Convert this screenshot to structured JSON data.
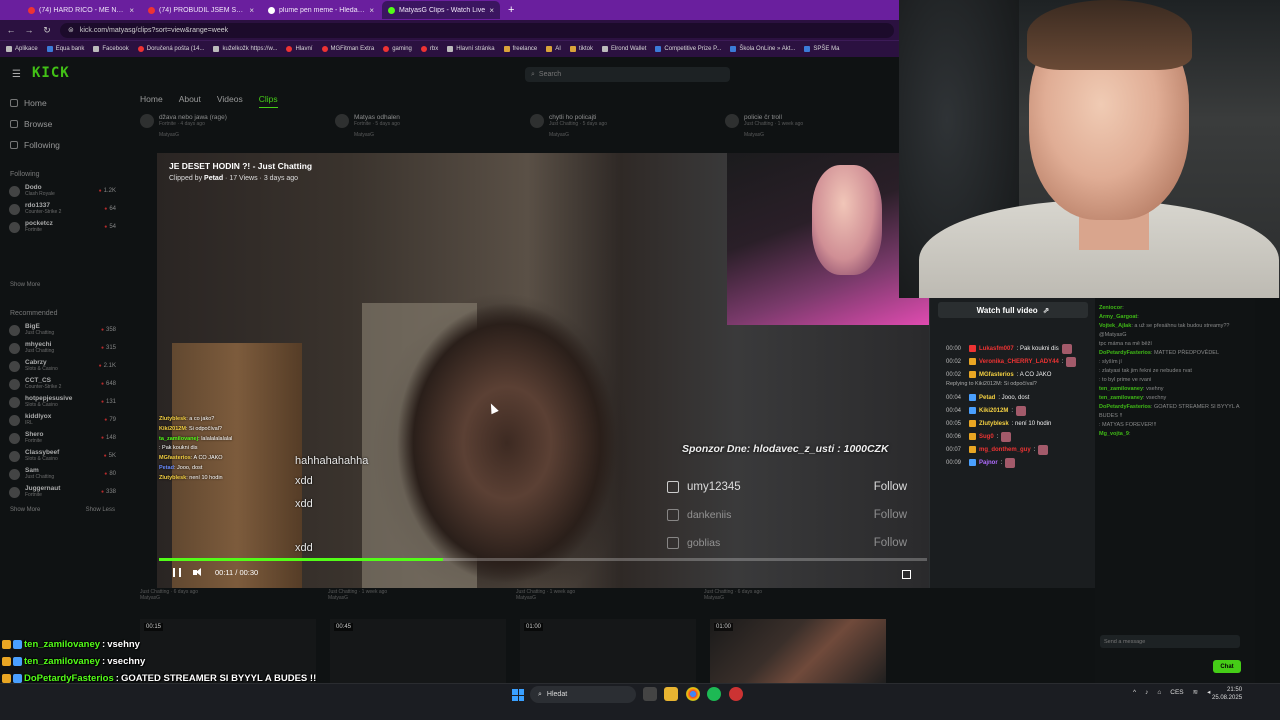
{
  "browser": {
    "tabs": [
      {
        "label": "(74) HARD RICO - MÉ NEDOSTI",
        "icon": "youtube-icon",
        "active": false
      },
      {
        "label": "(74) PROBUDIL JSEM SOUSEDE",
        "icon": "youtube-icon",
        "active": false
      },
      {
        "label": "plume pen meme - Hledat Goo",
        "icon": "google-icon",
        "active": false
      },
      {
        "label": "MatyasG Clips - Watch Live",
        "icon": "kick-icon",
        "active": true
      }
    ],
    "url": "kick.com/matyasg/clips?sort=view&range=week",
    "bookmarks": [
      "Aplikace",
      "Equa bank",
      "Facebook",
      "Doručená pošta (14...",
      "kuželkožk https://w...",
      "Hlavní",
      "MGFitman Extra",
      "gaming",
      "rbx",
      "Hlavní stránka",
      "freelance",
      "AI",
      "tiktok",
      "Elrond Wallet",
      "Competitive Prize P...",
      "Škola OnLine » Akt...",
      "SPŠE Ma"
    ]
  },
  "kick": {
    "search_placeholder": "Search",
    "nav": [
      "Home",
      "Browse",
      "Following"
    ],
    "following_title": "Following",
    "following": [
      {
        "name": "Dodo",
        "game": "Clash Royale",
        "viewers": "1.2K"
      },
      {
        "name": "rdo1337",
        "game": "Counter-Strike 2",
        "viewers": "64"
      },
      {
        "name": "pocketcz",
        "game": "Fortnite",
        "viewers": "54"
      }
    ],
    "show_more": "Show More",
    "recommended_title": "Recommended",
    "recommended": [
      {
        "name": "BigE",
        "game": "Just Chatting",
        "viewers": "358"
      },
      {
        "name": "mhyechi",
        "game": "Just Chatting",
        "viewers": "315"
      },
      {
        "name": "Cabrzy",
        "game": "Slots & Casino",
        "viewers": "2.1K"
      },
      {
        "name": "CCT_CS",
        "game": "Counter-Strike 2",
        "viewers": "648"
      },
      {
        "name": "hotpepjesusive",
        "game": "Slots & Casino",
        "viewers": "131"
      },
      {
        "name": "kiddlyox",
        "game": "IRL",
        "viewers": "79"
      },
      {
        "name": "Shero",
        "game": "Fortnite",
        "viewers": "148"
      },
      {
        "name": "Classybeef",
        "game": "Slots & Casino",
        "viewers": "5K"
      },
      {
        "name": "Sam",
        "game": "Just Chatting",
        "viewers": "80"
      },
      {
        "name": "Juggernaut",
        "game": "Fortnite",
        "viewers": "338"
      }
    ],
    "show_less": "Show Less",
    "channel_tabs": [
      "Home",
      "About",
      "Videos",
      "Clips"
    ],
    "active_tab": "Clips",
    "clip_cards": [
      {
        "title": "džava nebo jawa (rage)",
        "meta": "Fortnite · 4 days ago",
        "by": "MatyasG"
      },
      {
        "title": "Matyas odhalen",
        "meta": "Fortnite · 5 days ago",
        "by": "MatyasG"
      },
      {
        "title": "chytli ho policajti",
        "meta": "Just Chatting · 5 days ago",
        "by": "MatyasG"
      },
      {
        "title": "policie čr troll",
        "meta": "Just Chatting · 1 week ago",
        "by": "MatyasG"
      }
    ],
    "bottom_meta": [
      {
        "meta": "Just Chatting · 6 days ago",
        "by": "MatyasG"
      },
      {
        "meta": "Just Chatting · 1 week ago",
        "by": "MatyasG"
      },
      {
        "meta": "Just Chatting · 1 week ago",
        "by": "MatyasG"
      },
      {
        "meta": "Just Chatting · 6 days ago",
        "by": "MatyasG"
      }
    ],
    "thumb_times": [
      "00:15",
      "00:45",
      "01:00",
      "01:00",
      "01:00"
    ]
  },
  "clip": {
    "title": "JE DESET HODIN ?! - Just Chatting",
    "clipped_by_prefix": "Clipped by",
    "clipped_by": "Petad",
    "meta": "· 17 Views · 3 days ago",
    "time": "00:11 / 00:30",
    "progress": 0.37,
    "video_text": {
      "hah": "hahhahahahha",
      "xdd": [
        "xdd",
        "xdd",
        "xdd"
      ],
      "sponsor": "Sponzor Dne: hlodavec_z_usti : 1000CZK",
      "follows": [
        {
          "name": "umy12345",
          "btn": "Follow"
        },
        {
          "name": "dankeniis",
          "btn": "Follow"
        },
        {
          "name": "goblias",
          "btn": "Follow"
        }
      ]
    },
    "video_chat": [
      {
        "user": "Zlutyblesk",
        "msg": ": a co jako?",
        "color": "#f5d142"
      },
      {
        "user": "Kiki2012M",
        "msg": ": Si odpočíval?",
        "color": "#f5d142"
      },
      {
        "user": "ta_zamilovanej",
        "msg": ": lalalalalalalal",
        "color": "#53fc18"
      },
      {
        "user": "",
        "msg": ": Pak koukni dis",
        "color": "#e33"
      },
      {
        "user": "MGfasterios",
        "msg": ": A CO JAKO",
        "color": "#f5d142"
      },
      {
        "user": "Petad",
        "msg": ": Jooo, dost",
        "color": "#6a8cff"
      },
      {
        "user": "Zlutyblesk",
        "msg": ": není 10 hodin",
        "color": "#f5d142"
      }
    ]
  },
  "replay": {
    "watch_full": "Watch full video",
    "lines": [
      {
        "time": "00:00",
        "user": "Lukasfm007",
        "msg": ": Pak koukni dis",
        "color": "#e33",
        "emote": true
      },
      {
        "time": "00:02",
        "user": "Veronika_CHERRY_LADY44",
        "msg": ":",
        "color": "#e33",
        "emote": true
      },
      {
        "time": "00:02",
        "user": "MGfasterios",
        "msg": ": A CO JAKO",
        "color": "#f5d142",
        "emote": false
      },
      {
        "time": "00:04",
        "user": "Petad",
        "msg": ": Jooo, dost",
        "color": "#f5d142",
        "emote": false,
        "reply": "Replying to Kiki2012M: Si odpočíval?"
      },
      {
        "time": "00:04",
        "user": "Kiki2012M",
        "msg": ":",
        "color": "#f5d142",
        "emote": true
      },
      {
        "time": "00:05",
        "user": "Zlutyblesk",
        "msg": ": není 10 hodin",
        "color": "#f5d142",
        "emote": false
      },
      {
        "time": "00:06",
        "user": "Sug0",
        "msg": ":",
        "color": "#e33",
        "emote": true
      },
      {
        "time": "00:07",
        "user": "mg_donthem_guy",
        "msg": ":",
        "color": "#e33",
        "emote": true
      },
      {
        "time": "00:09",
        "user": "Pajnor",
        "msg": ":",
        "color": "#b06cff",
        "emote": true
      }
    ]
  },
  "stream_chat": {
    "lines": [
      {
        "user": "Zeniocor",
        "msg": ":"
      },
      {
        "user": "Army_Gargoat",
        "msg": ":"
      },
      {
        "user": "Vojtek_Ajlak",
        "msg": ": a už se přesáhnu tak budou streamy?? @MatyasG"
      },
      {
        "user": "",
        "msg": "tpc máma na mě běží"
      },
      {
        "user": "DoPetardyFasterios",
        "msg": ": MATTED PŘEDPOVĚDEL"
      },
      {
        "user": "",
        "msg": ": slyším jí"
      },
      {
        "user": "",
        "msg": ": zlatyasi tak jim řekni ze nebudes rvat"
      },
      {
        "user": "",
        "msg": ": to byl prime ve rvani"
      },
      {
        "user": "ten_zamilovaney",
        "msg": ": vsehny"
      },
      {
        "user": "ten_zamilovaney",
        "msg": ": vsechny"
      },
      {
        "user": "DoPetardyFasterios",
        "msg": ": GOATED STREAMER SI BYYYL A BUDES !!"
      },
      {
        "user": "",
        "msg": ": MATYAS FOREVER!!!"
      },
      {
        "user": "Mg_vojta_9",
        "msg": ":"
      }
    ],
    "input_placeholder": "Send a message",
    "chat_button": "Chat"
  },
  "overlay_chat": [
    {
      "user": "ten_zamilovaney",
      "msg": "vsehny",
      "color": "#53fc18",
      "emote": false
    },
    {
      "user": "ten_zamilovaney",
      "msg": "vsechny",
      "color": "#53fc18",
      "emote": false
    },
    {
      "user": "DoPetardyFasterios",
      "msg": "GOATED STREAMER SI BYYYL A BUDES !!",
      "color": "#53fc18",
      "emote": false
    },
    {
      "user": "Veronika_CHERRY_LADY44",
      "msg": "MATYAS FOREVER!!!",
      "color": "#e33",
      "emote": false
    },
    {
      "user": "Mg_vojta_9",
      "msg": "",
      "color": "#53fc18",
      "emote": true
    }
  ],
  "taskbar": {
    "search_placeholder": "Hledat",
    "lang": "CES",
    "time": "21:50",
    "date": "25.08.2025"
  },
  "colors": {
    "kick_green": "#53fc18",
    "browser_purple": "#6a1f9e"
  }
}
